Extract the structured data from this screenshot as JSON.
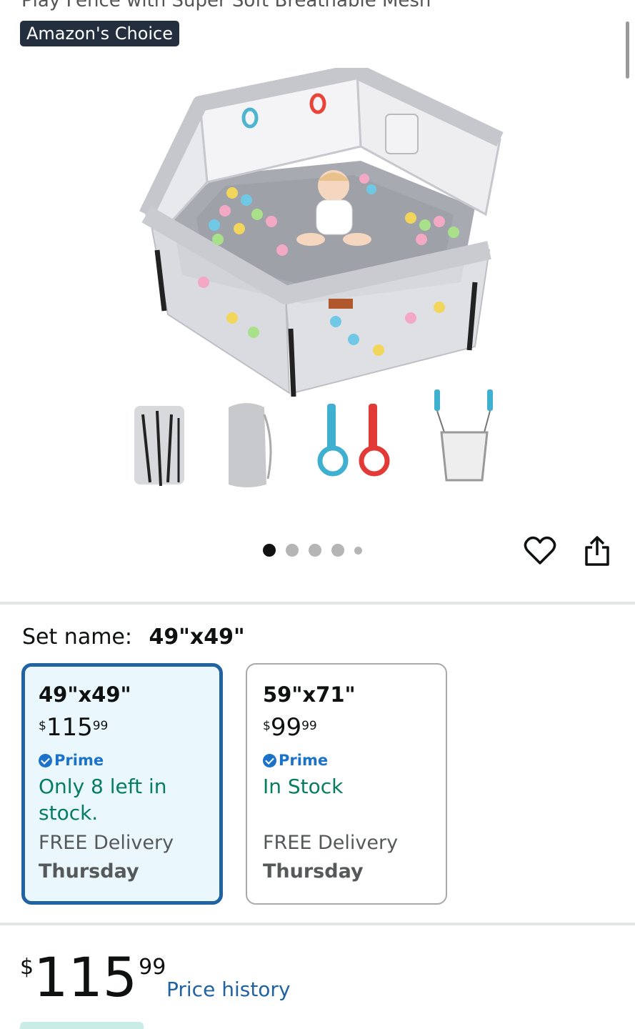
{
  "header": {
    "title_partial": "Play Fence with Super Soft Breathable Mesh",
    "badge": "Amazon's Choice"
  },
  "gallery": {
    "image_count": 5,
    "active_index": 0
  },
  "actions": {
    "wishlist_icon": "heart-icon",
    "share_icon": "share-icon"
  },
  "variation": {
    "label": "Set name:",
    "selected_value": "49\"x49\"",
    "options": [
      {
        "size": "49\"x49\"",
        "price_symbol": "$",
        "price_whole": "115",
        "price_fraction": "99",
        "prime": "Prime",
        "stock": "Only 8 left in stock.",
        "delivery_label": "FREE Delivery",
        "delivery_day": "Thursday",
        "selected": true
      },
      {
        "size": "59\"x71\"",
        "price_symbol": "$",
        "price_whole": "99",
        "price_fraction": "99",
        "prime": "Prime",
        "stock": "In Stock",
        "delivery_label": "FREE Delivery",
        "delivery_day": "Thursday",
        "selected": false
      }
    ]
  },
  "price": {
    "symbol": "$",
    "whole": "115",
    "fraction": "99",
    "history_link": "Price history"
  },
  "colors": {
    "selected_border": "#2162a1",
    "selected_bg": "#eaf7fd",
    "stock_green": "#067d62",
    "prime_blue": "#1a73c9",
    "badge_bg": "#232f3e"
  }
}
